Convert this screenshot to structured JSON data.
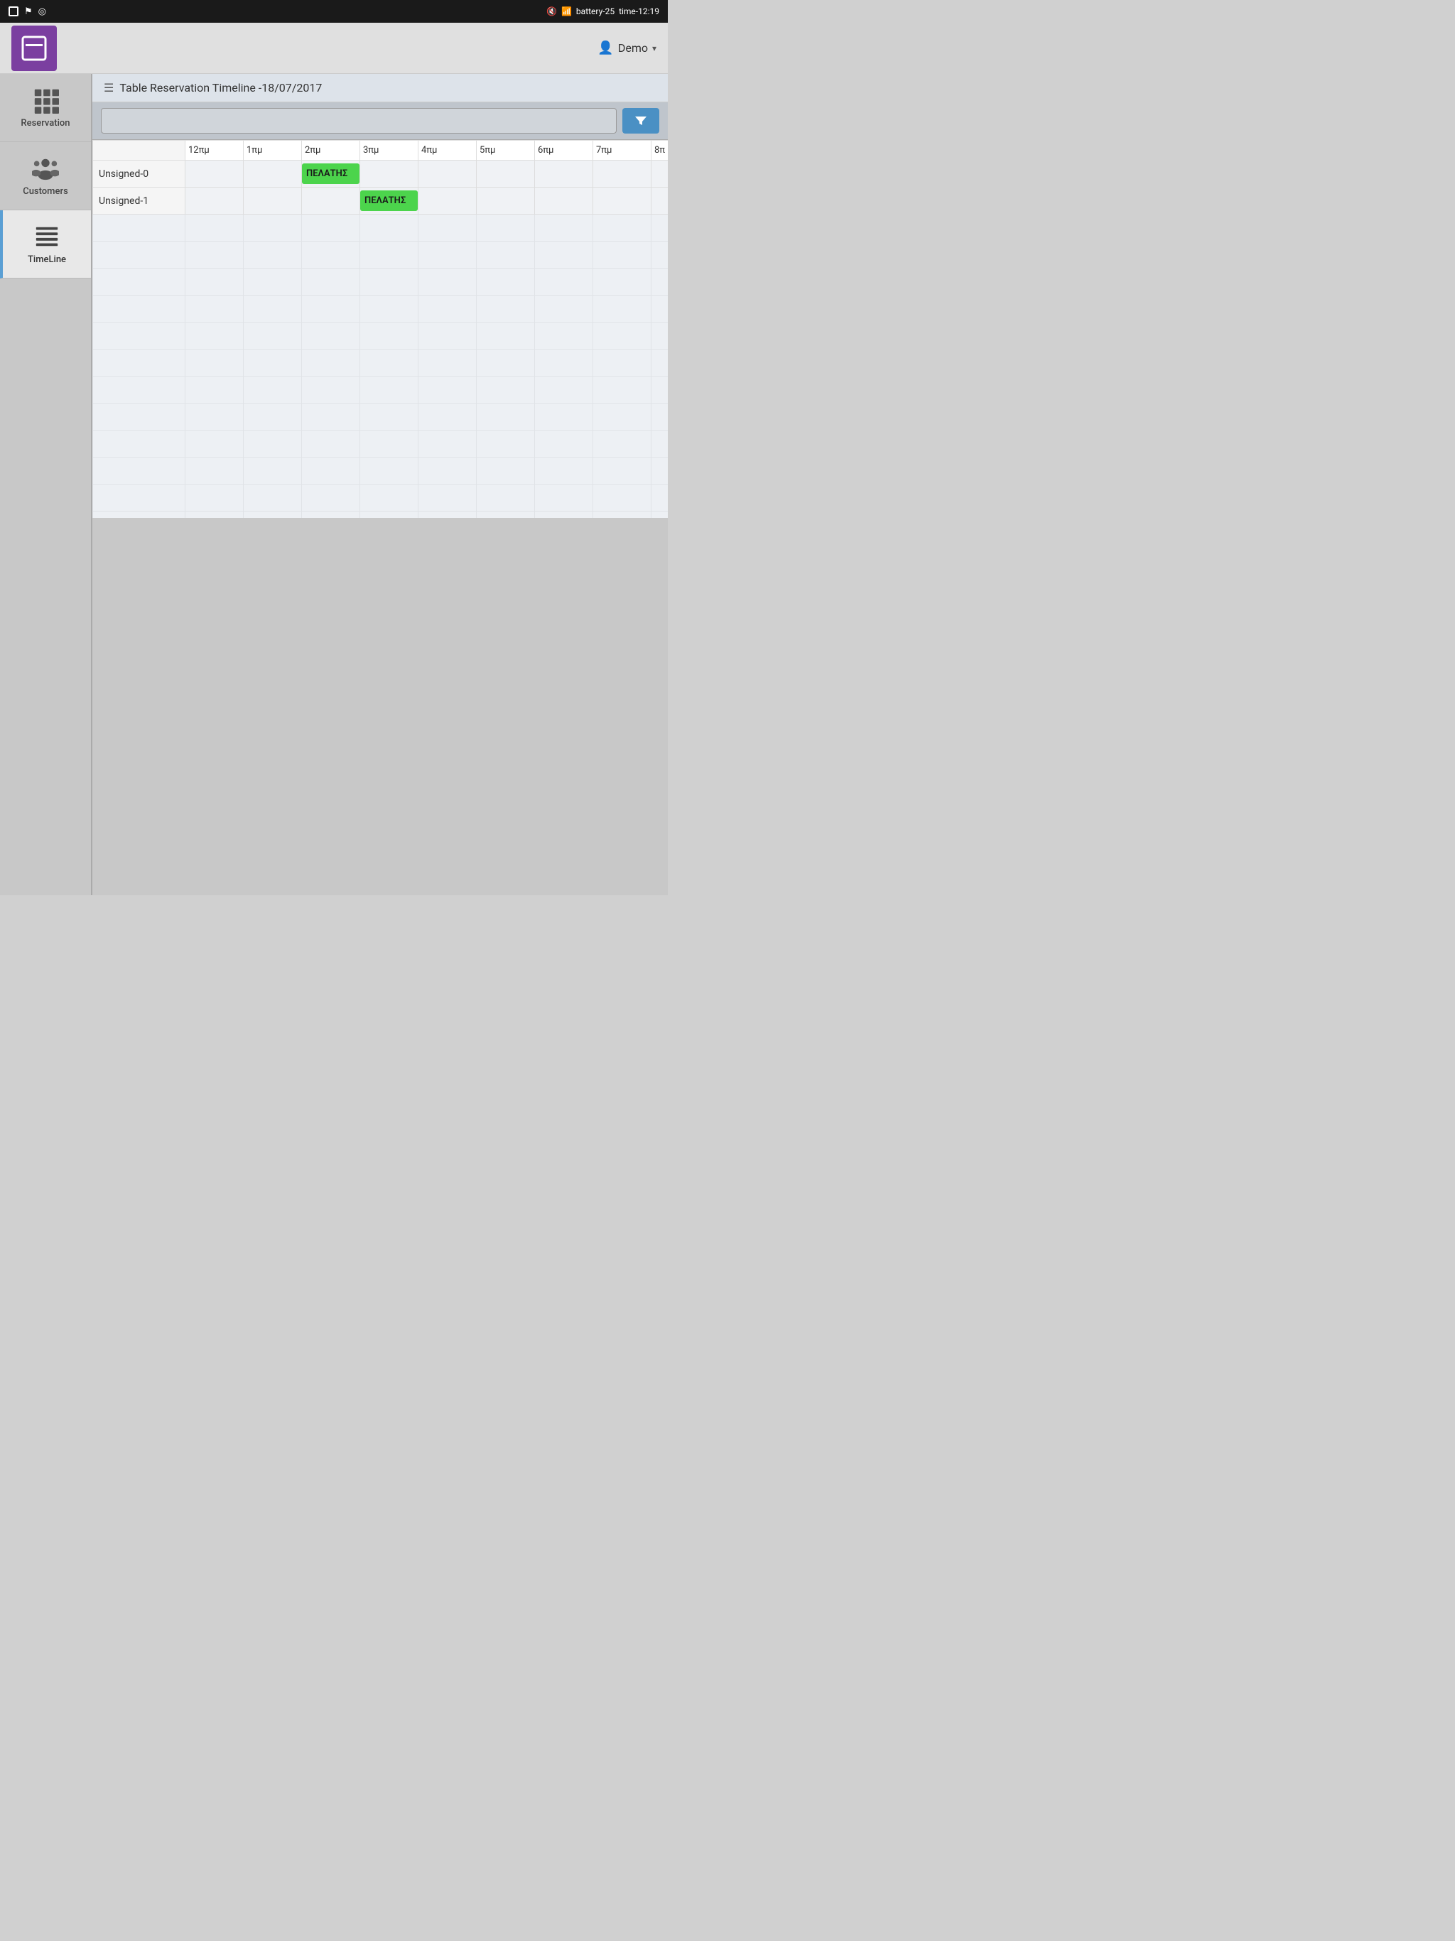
{
  "statusBar": {
    "leftIcons": [
      "image-icon",
      "flag-icon",
      "target-icon"
    ],
    "rightItems": [
      "mute-icon",
      "wifi-icon",
      "battery-25",
      "time-12:19"
    ]
  },
  "header": {
    "logoAlt": "App Logo",
    "userLabel": "Demo",
    "chevron": "▾"
  },
  "sidebar": {
    "items": [
      {
        "id": "reservation",
        "label": "Reservation",
        "icon": "grid-icon",
        "active": false
      },
      {
        "id": "customers",
        "label": "Customers",
        "icon": "people-icon",
        "active": false
      },
      {
        "id": "timeline",
        "label": "TimeLine",
        "icon": "timeline-icon",
        "active": true
      }
    ]
  },
  "page": {
    "title": "Table Reservation Timeline -18/07/2017",
    "filterPlaceholder": "",
    "filterButtonLabel": "▼"
  },
  "timeline": {
    "timeSlots": [
      "12πμ",
      "1πμ",
      "2πμ",
      "3πμ",
      "4πμ",
      "5πμ",
      "6πμ",
      "7πμ",
      "8π"
    ],
    "rows": [
      {
        "label": "Unsigned-0",
        "reservations": [
          {
            "label": "ΠΕΛΑΤΗΣ",
            "startSlot": 2,
            "spanSlots": 1,
            "color": "green"
          }
        ]
      },
      {
        "label": "Unsigned-1",
        "reservations": [
          {
            "label": "ΠΕΛΑΤΗΣ",
            "startSlot": 3,
            "spanSlots": 1,
            "color": "green"
          }
        ]
      }
    ]
  }
}
